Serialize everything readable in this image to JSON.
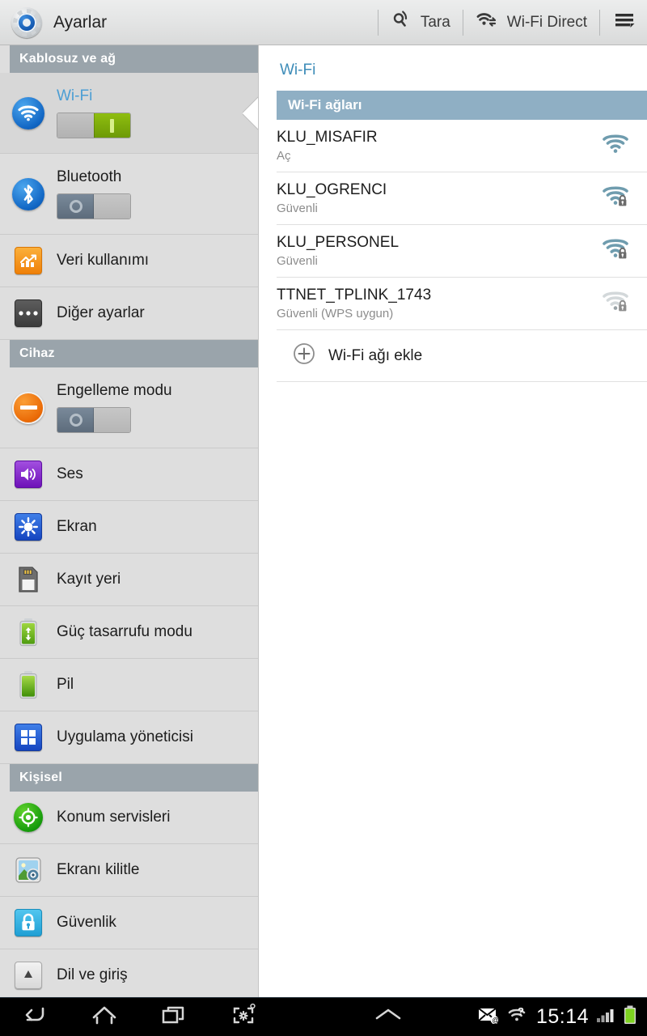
{
  "actionbar": {
    "app_icon": "settings-gear-icon",
    "title": "Ayarlar",
    "scan": {
      "label": "Tara",
      "icon": "scan-icon"
    },
    "wifi_direct": {
      "label": "Wi-Fi Direct",
      "icon": "wifi-direct-icon"
    },
    "overflow": {
      "icon": "overflow-menu-icon"
    }
  },
  "sidebar": {
    "sections": [
      {
        "title": "Kablosuz ve ağ",
        "items": [
          {
            "label": "Wi-Fi",
            "icon": "wifi-icon",
            "selected": true,
            "toggle": "on"
          },
          {
            "label": "Bluetooth",
            "icon": "bluetooth-icon",
            "selected": false,
            "toggle": "off"
          },
          {
            "label": "Veri kullanımı",
            "icon": "data-usage-icon",
            "selected": false
          },
          {
            "label": "Diğer ayarlar",
            "icon": "more-settings-icon",
            "selected": false
          }
        ]
      },
      {
        "title": "Cihaz",
        "items": [
          {
            "label": "Engelleme modu",
            "icon": "blocking-mode-icon",
            "selected": false,
            "toggle": "off"
          },
          {
            "label": "Ses",
            "icon": "sound-icon",
            "selected": false
          },
          {
            "label": "Ekran",
            "icon": "display-icon",
            "selected": false
          },
          {
            "label": "Kayıt yeri",
            "icon": "storage-icon",
            "selected": false
          },
          {
            "label": "Güç tasarrufu modu",
            "icon": "power-saving-icon",
            "selected": false
          },
          {
            "label": "Pil",
            "icon": "battery-icon",
            "selected": false
          },
          {
            "label": "Uygulama yöneticisi",
            "icon": "application-manager-icon",
            "selected": false
          }
        ]
      },
      {
        "title": "Kişisel",
        "items": [
          {
            "label": "Konum servisleri",
            "icon": "location-services-icon",
            "selected": false
          },
          {
            "label": "Ekranı kilitle",
            "icon": "lock-screen-icon",
            "selected": false
          },
          {
            "label": "Güvenlik",
            "icon": "security-icon",
            "selected": false
          },
          {
            "label": "Dil ve giriş",
            "icon": "language-input-icon",
            "selected": false
          }
        ]
      }
    ]
  },
  "pane": {
    "title": "Wi-Fi",
    "networks_header": "Wi-Fi ağları",
    "networks": [
      {
        "ssid": "KLU_MISAFIR",
        "status": "Aç",
        "secured": false,
        "strength": 4
      },
      {
        "ssid": "KLU_OGRENCI",
        "status": "Güvenli",
        "secured": true,
        "strength": 4
      },
      {
        "ssid": "KLU_PERSONEL",
        "status": "Güvenli",
        "secured": true,
        "strength": 4
      },
      {
        "ssid": "TTNET_TPLINK_1743",
        "status": "Güvenli (WPS uygun)",
        "secured": true,
        "strength": 1
      }
    ],
    "add_network": {
      "label": "Wi-Fi ağı ekle",
      "icon": "plus-circle-icon"
    }
  },
  "navbar": {
    "back": "back-icon",
    "home": "home-icon",
    "recents": "recent-apps-icon",
    "screenshot": "screen-capture-icon",
    "expand": "chevron-up-icon",
    "status": {
      "email": "email-icon",
      "wifi_unknown": "wifi-question-icon",
      "time": "15:14",
      "signal": "signal-bars-icon",
      "battery": "battery-icon"
    }
  },
  "colors": {
    "accent_blue": "#4b9ed4",
    "pane_title_blue": "#3d8cb8",
    "section_header_gray": "#9aa4ab",
    "wifi_header_blue": "#8fafc4",
    "toggle_on_green": "#7aab0b",
    "signal_teal": "#6f9cae",
    "signal_faded": "#cfd4d6"
  }
}
